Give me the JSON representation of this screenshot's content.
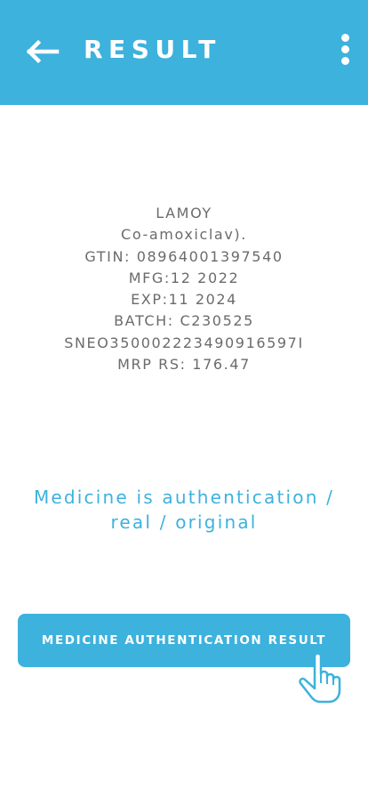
{
  "header": {
    "title": "RESULT",
    "back_icon": "arrow-left-icon",
    "menu_icon": "more-vertical-icon",
    "background_color": "#3cb2dd"
  },
  "product": {
    "lines": [
      "LAMOY",
      "Co-amoxiclav).",
      "GTIN: 08964001397540",
      "MFG:12 2022",
      "EXP:11 2024",
      "BATCH: C230525",
      "SNEO350002223490916597I",
      "MRP RS: 176.47"
    ]
  },
  "status": {
    "line1": "Medicine is authentication /",
    "line2": "real / original",
    "color": "#3cb2dd"
  },
  "action": {
    "button_label": "MEDICINE AUTHENTICATION RESULT",
    "pointer_icon": "hand-pointer-icon"
  }
}
